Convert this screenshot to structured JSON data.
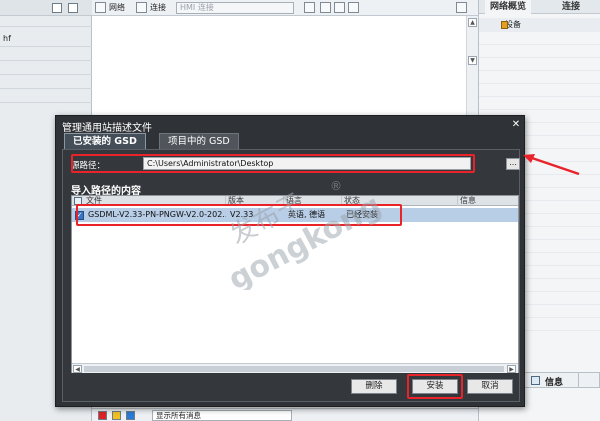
{
  "background": {
    "tree_items": [
      "hf"
    ],
    "toolbar": {
      "network_label": "网络",
      "connect_label": "连接",
      "connection_combo_placeholder": "HMI 连接"
    },
    "right_panel": {
      "tab_network_overview": "网络概览",
      "tab_connections": "连接",
      "devices_header": "设备"
    },
    "info_tab_label": "信息",
    "messages_filter_value": "显示所有消息"
  },
  "dialog": {
    "title": "管理通用站描述文件",
    "close_glyph": "✕",
    "tabs": [
      {
        "label": "已安装的 GSD",
        "active": true
      },
      {
        "label": "项目中的 GSD",
        "active": false
      }
    ],
    "source_path_label": "源路径：",
    "source_path_value": "C:\\Users\\Administrator\\Desktop",
    "browse_label": "...",
    "section_title": "导入路径的内容",
    "table": {
      "columns": [
        "文件",
        "版本",
        "语言",
        "状态",
        "信息"
      ],
      "rows": [
        {
          "checked": true,
          "file": "GSDML-V2.33-PN-PNGW-V2.0-202...",
          "version": "V2.33",
          "language": "英语, 德语",
          "status": "已经安装",
          "info": ""
        }
      ]
    },
    "buttons": {
      "delete": "删除",
      "install": "安装",
      "cancel": "取消"
    }
  },
  "watermark": {
    "text_cn": "发布于",
    "text_en": "gongkong",
    "registered": "®"
  },
  "colors": {
    "highlight_red": "#e8232a",
    "dialog_bg": "#2f3236",
    "row_selected": "#b8cde6"
  }
}
